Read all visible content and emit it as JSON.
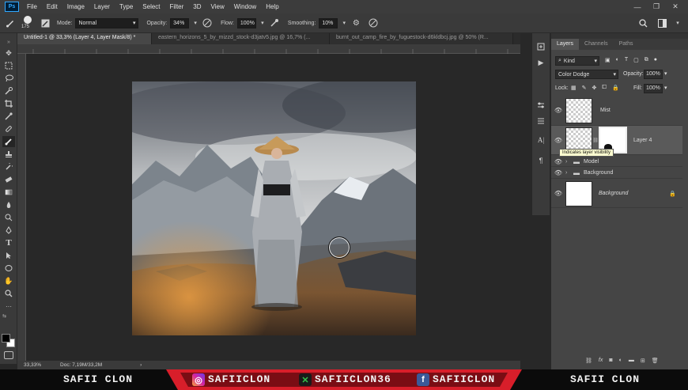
{
  "menubar": {
    "logo": "Ps",
    "items": [
      "File",
      "Edit",
      "Image",
      "Layer",
      "Type",
      "Select",
      "Filter",
      "3D",
      "View",
      "Window",
      "Help"
    ]
  },
  "options": {
    "brush_size": "175",
    "mode_label": "Mode:",
    "mode_value": "Normal",
    "opacity_label": "Opacity:",
    "opacity_value": "34%",
    "flow_label": "Flow:",
    "flow_value": "100%",
    "smoothing_label": "Smoothing:",
    "smoothing_value": "10%"
  },
  "tabs": [
    {
      "label": "Untitled-1 @ 33,3% (Layer 4, Layer Mask/8) *"
    },
    {
      "label": "eastern_horizons_5_by_mizzd_stock-d3jatv5.jpg @ 16,7% (..."
    },
    {
      "label": "burnt_out_camp_fire_by_fuguestock-d6kldbcj.jpg @ 50% (R..."
    }
  ],
  "status": {
    "zoom": "33,33%",
    "doc": "Doc: 7,19M/33,2M"
  },
  "layers_panel": {
    "tabs": [
      "Layers",
      "Channels",
      "Paths"
    ],
    "kind_label": "Kind",
    "blend_mode": "Color Dodge",
    "opacity_label": "Opacity:",
    "opacity_value": "100%",
    "lock_label": "Lock:",
    "fill_label": "Fill:",
    "fill_value": "100%",
    "tooltip": "Indicates layer visibility",
    "layers": [
      {
        "name": "Mist"
      },
      {
        "name": "Layer 4"
      },
      {
        "name": "Model"
      },
      {
        "name": "Background"
      },
      {
        "name": "Background"
      }
    ]
  },
  "banner": {
    "left_name": "SAFII CLON",
    "instagram": "SAFIICLON",
    "other": "SAFIICLON36",
    "facebook": "SAFIICLON",
    "right_name": "SAFII CLON"
  },
  "colors": {
    "accent_red": "#d81e2a",
    "ps_blue": "#31a8ff",
    "panel_bg": "#454545"
  }
}
